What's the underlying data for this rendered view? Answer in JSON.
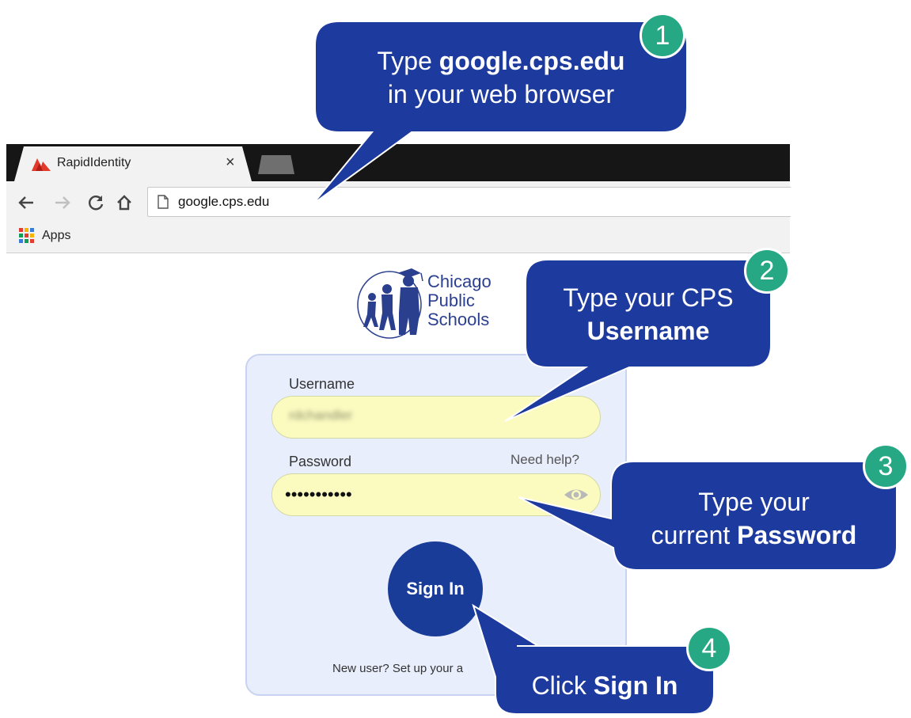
{
  "browser": {
    "tab_title": "RapidIdentity",
    "tab_close": "×",
    "url": "google.cps.edu",
    "bookmarks": [
      {
        "label": "Apps",
        "icon": "apps-grid-icon"
      }
    ],
    "nav_icons": [
      "back-arrow-icon",
      "forward-arrow-icon",
      "reload-icon",
      "home-icon"
    ]
  },
  "logo": {
    "lines": [
      "Chicago",
      "Public",
      "Schools"
    ]
  },
  "login": {
    "username_label": "Username",
    "username_value": "rdchandler",
    "password_label": "Password",
    "password_value": "•••••••••••",
    "need_help": "Need help?",
    "sign_in": "Sign In",
    "new_user_text": "New user? Set up your a"
  },
  "callouts": [
    {
      "number": "1",
      "parts": [
        "Type ",
        "google.cps.edu",
        "in your web browser"
      ]
    },
    {
      "number": "2",
      "parts": [
        "Type your CPS",
        "Username"
      ]
    },
    {
      "number": "3",
      "parts": [
        "Type your",
        "current ",
        "Password"
      ]
    },
    {
      "number": "4",
      "parts": [
        "Click ",
        "Sign In"
      ]
    }
  ],
  "colors": {
    "callout_fill": "#1d3a9e",
    "badge_fill": "#27a884",
    "card_bg": "#e8eefc",
    "field_bg": "#fbfbc0",
    "signin_bg": "#1a3c99"
  }
}
